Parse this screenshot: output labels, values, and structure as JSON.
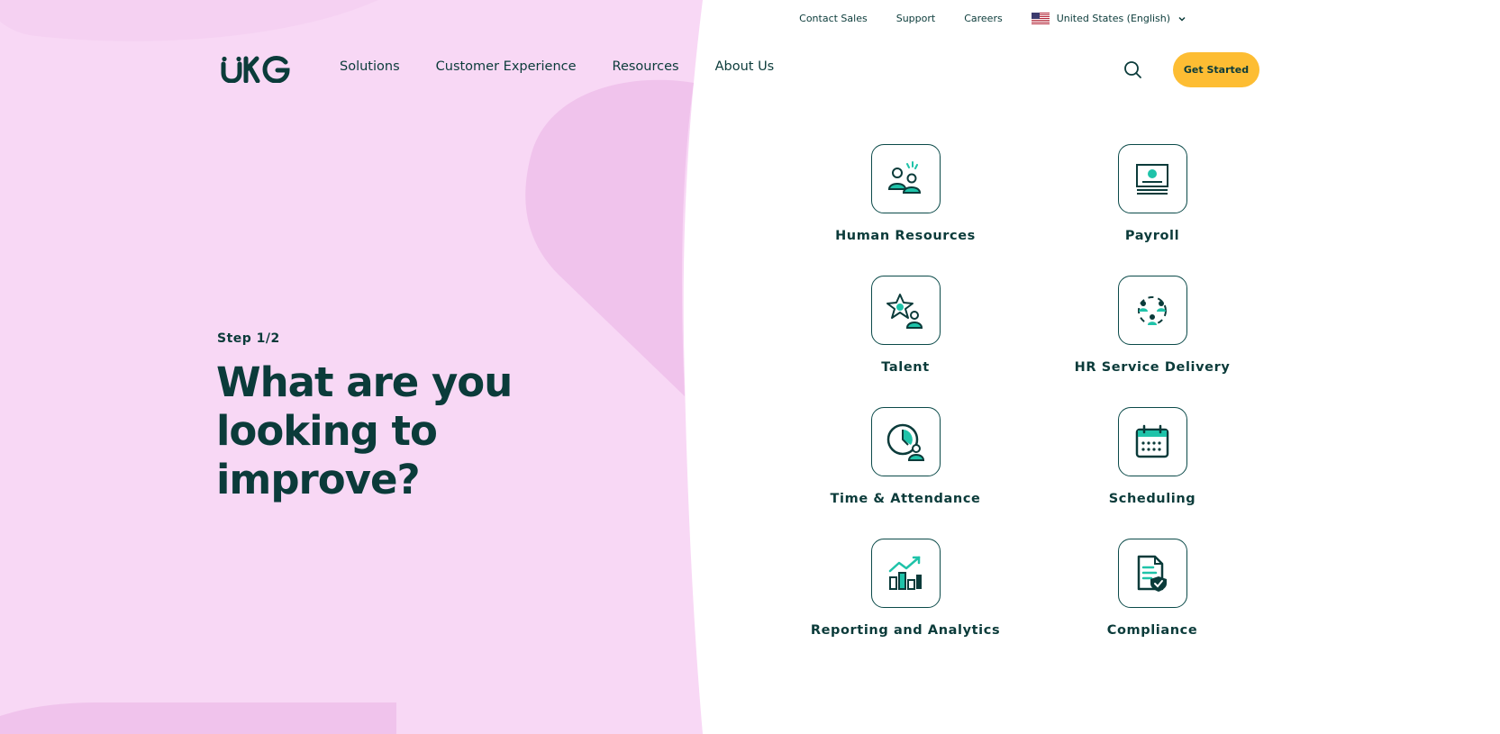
{
  "colors": {
    "pink": "#f8d8f5",
    "pink_dark": "#f0c3ec",
    "teal_dark": "#0b3b3a",
    "teal_accent": "#1fc3a9",
    "yellow": "#fdbd33"
  },
  "utility_nav": {
    "contact_sales": "Contact Sales",
    "support": "Support",
    "careers": "Careers",
    "locale": "United States (English)",
    "flag_icon": "us-flag-icon"
  },
  "header": {
    "logo_text": "UKG",
    "nav": [
      "Solutions",
      "Customer Experience",
      "Resources",
      "About Us"
    ],
    "search_icon": "search-icon",
    "cta": "Get Started"
  },
  "hero": {
    "step": "Step 1/2",
    "headline": "What are you looking to improve?"
  },
  "options": [
    {
      "label": "Human Resources",
      "icon": "people-icon"
    },
    {
      "label": "Payroll",
      "icon": "payroll-icon"
    },
    {
      "label": "Talent",
      "icon": "talent-star-icon"
    },
    {
      "label": "HR Service Delivery",
      "icon": "service-network-icon"
    },
    {
      "label": "Time & Attendance",
      "icon": "clock-person-icon"
    },
    {
      "label": "Scheduling",
      "icon": "calendar-icon"
    },
    {
      "label": "Reporting and Analytics",
      "icon": "bar-chart-icon"
    },
    {
      "label": "Compliance",
      "icon": "document-shield-icon"
    }
  ]
}
